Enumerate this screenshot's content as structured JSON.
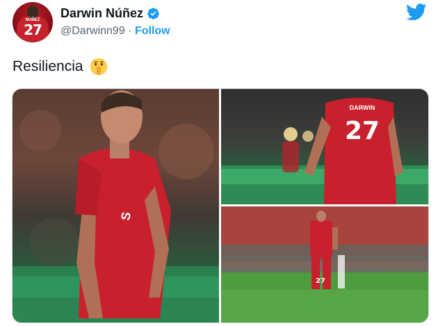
{
  "user": {
    "display_name": "Darwin Núñez",
    "handle": "@Darwinn99",
    "separator": "·",
    "follow_label": "Follow",
    "avatar_number": "27",
    "avatar_name": "NÚÑEZ"
  },
  "tweet": {
    "text": "Resiliencia",
    "emoji": "shushing-face"
  },
  "media": {
    "photos": [
      {
        "id": "photo-1",
        "shirt_number": "",
        "shirt_name": ""
      },
      {
        "id": "photo-2",
        "shirt_number": "27",
        "shirt_name": "DARWIN"
      },
      {
        "id": "photo-3",
        "shirt_number": "27",
        "shirt_name": ""
      }
    ]
  },
  "colors": {
    "accent": "#1d9bf0",
    "text": "#0f1419",
    "muted": "#536471",
    "kit_red": "#c8202d"
  },
  "icons": [
    "verified-badge-icon",
    "twitter-bird-icon",
    "shushing-face-emoji"
  ]
}
